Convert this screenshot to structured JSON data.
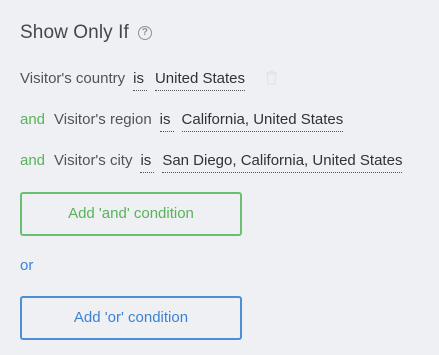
{
  "header": {
    "title": "Show Only If",
    "help_icon": "question-circle-icon"
  },
  "conditions": [
    {
      "conjunction": "",
      "field": "Visitor's country",
      "operator": "is",
      "value": "United States",
      "action_icon": "trash-icon"
    },
    {
      "conjunction": "and",
      "field": "Visitor's region",
      "operator": "is",
      "value": "California, United States"
    },
    {
      "conjunction": "and",
      "field": "Visitor's city",
      "operator": "is",
      "value": "San Diego, California, United States"
    }
  ],
  "actions": {
    "add_and_label": "Add 'and' condition",
    "or_label": "or",
    "add_or_label": "Add 'or' condition"
  },
  "colors": {
    "and_green": "#58b35a",
    "or_blue": "#3b82d4",
    "background": "#eef0f3"
  }
}
